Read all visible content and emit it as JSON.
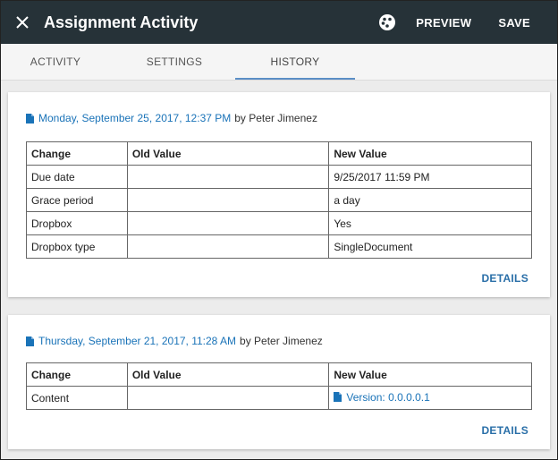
{
  "header": {
    "close_icon": "close-icon",
    "title": "Assignment Activity",
    "palette_icon": "palette-icon",
    "preview_label": "PREVIEW",
    "save_label": "SAVE",
    "background_color": "#263238"
  },
  "tabs": [
    {
      "label": "ACTIVITY",
      "active": false
    },
    {
      "label": "SETTINGS",
      "active": false
    },
    {
      "label": "HISTORY",
      "active": true
    }
  ],
  "accent_color": "#1a73b8",
  "history": [
    {
      "date": "Monday, September 25, 2017, 12:37 PM",
      "by": "by Peter Jimenez",
      "columns": [
        "Change",
        "Old Value",
        "New Value"
      ],
      "rows": [
        {
          "change": "Due date",
          "old": "",
          "new": "9/25/2017 11:59 PM"
        },
        {
          "change": "Grace period",
          "old": "",
          "new": "a day"
        },
        {
          "change": "Dropbox",
          "old": "",
          "new": "Yes"
        },
        {
          "change": "Dropbox type",
          "old": "",
          "new": "SingleDocument"
        }
      ],
      "details_label": "DETAILS"
    },
    {
      "date": "Thursday, September 21, 2017, 11:28 AM",
      "by": "by Peter Jimenez",
      "columns": [
        "Change",
        "Old Value",
        "New Value"
      ],
      "rows": [
        {
          "change": "Content",
          "old": "",
          "new": "Version: 0.0.0.0.1",
          "new_is_link": true
        }
      ],
      "details_label": "DETAILS"
    }
  ]
}
